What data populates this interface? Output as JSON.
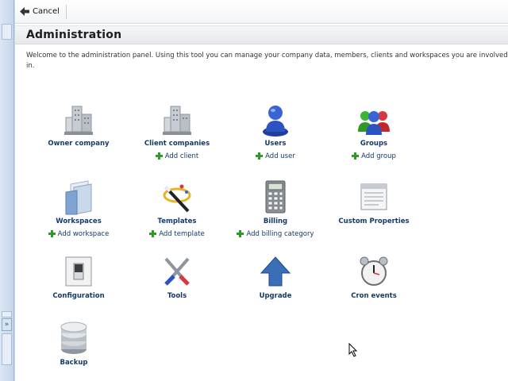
{
  "toolbar": {
    "cancel_label": "Cancel"
  },
  "page": {
    "title": "Administration",
    "welcome": "Welcome to the administration panel. Using this tool you can manage your company data, members, clients and workspaces you are involved in."
  },
  "items": [
    {
      "label": "Owner company",
      "icon": "building-icon"
    },
    {
      "label": "Client companies",
      "icon": "building-icon",
      "add": "Add client"
    },
    {
      "label": "Users",
      "icon": "user-icon",
      "add": "Add user"
    },
    {
      "label": "Groups",
      "icon": "group-icon",
      "add": "Add group"
    },
    {
      "label": "Workspaces",
      "icon": "folder-icon",
      "add": "Add workspace"
    },
    {
      "label": "Templates",
      "icon": "wand-icon",
      "add": "Add template"
    },
    {
      "label": "Billing",
      "icon": "calculator-icon",
      "add": "Add billing category"
    },
    {
      "label": "Custom Properties",
      "icon": "form-icon"
    },
    {
      "label": "Configuration",
      "icon": "switch-icon"
    },
    {
      "label": "Tools",
      "icon": "tools-icon"
    },
    {
      "label": "Upgrade",
      "icon": "upgrade-arrow-icon"
    },
    {
      "label": "Cron events",
      "icon": "alarm-clock-icon"
    },
    {
      "label": "Backup",
      "icon": "database-icon"
    }
  ],
  "colors": {
    "link": "#163a66",
    "add_plus": "#2f9a2a"
  }
}
